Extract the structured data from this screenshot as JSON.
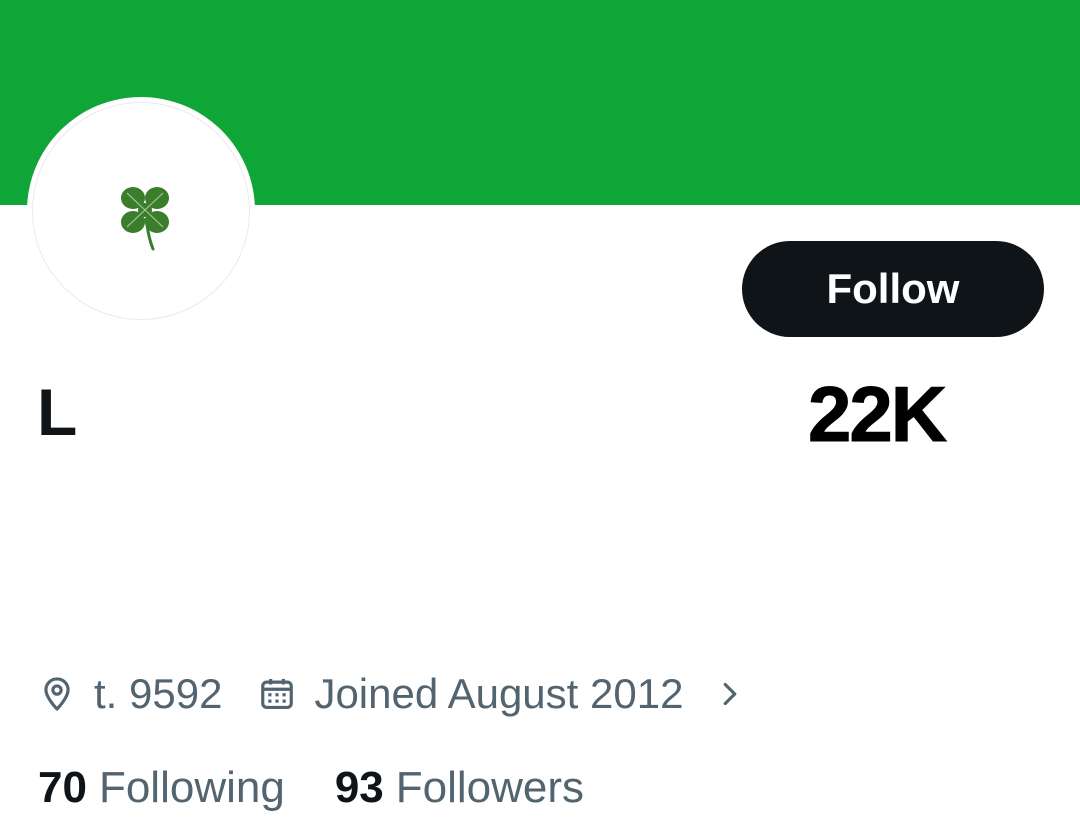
{
  "colors": {
    "banner": "#10a537",
    "follow_button_bg": "#0f1419",
    "follow_button_text": "#ffffff",
    "primary_text": "#0f1419",
    "secondary_text": "#536471",
    "clover": "#3a7d2a"
  },
  "profile": {
    "avatar_icon": "four-leaf-clover-icon",
    "display_name": "L",
    "follow_label": "Follow",
    "overlay_count": "22K"
  },
  "meta": {
    "location_icon": "location-pin-icon",
    "location": "t. 9592",
    "calendar_icon": "calendar-icon",
    "joined": "Joined August 2012",
    "more_icon": "chevron-right-icon"
  },
  "stats": {
    "following_count": "70",
    "following_label": "Following",
    "followers_count": "93",
    "followers_label": "Followers"
  }
}
